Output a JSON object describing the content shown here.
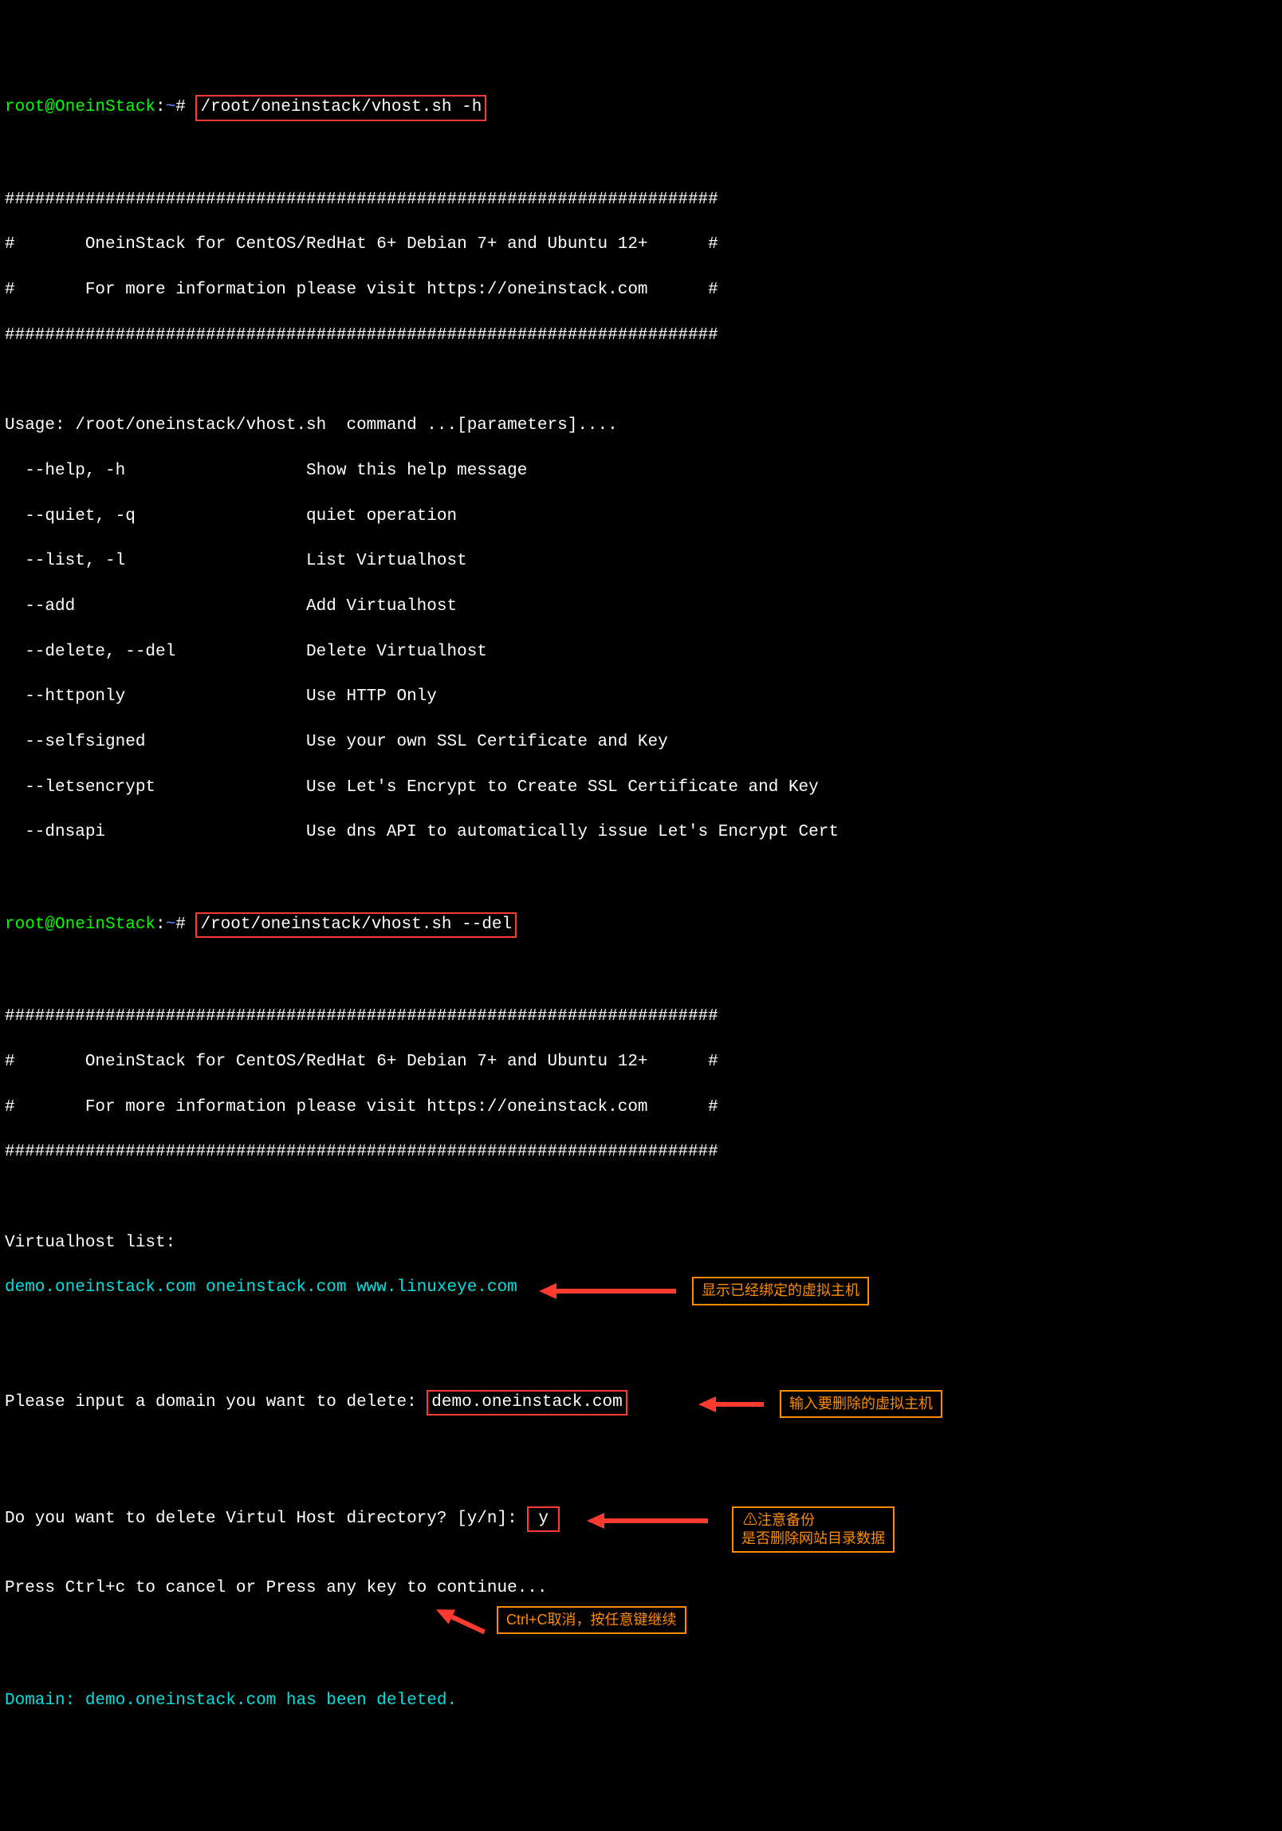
{
  "prompt1": {
    "user": "root@OneinStack",
    "sep": ":",
    "path": "~",
    "hash": "#",
    "command": "/root/oneinstack/vhost.sh -h"
  },
  "banner": {
    "hashline": "#######################################################################",
    "line1": "#       OneinStack for CentOS/RedHat 6+ Debian 7+ and Ubuntu 12+      #",
    "line2": "#       For more information please visit https://oneinstack.com      #"
  },
  "usage": {
    "header": "Usage: /root/oneinstack/vhost.sh  command ...[parameters]....",
    "rows": [
      "  --help, -h                  Show this help message",
      "  --quiet, -q                 quiet operation",
      "  --list, -l                  List Virtualhost",
      "  --add                       Add Virtualhost",
      "  --delete, --del             Delete Virtualhost",
      "  --httponly                  Use HTTP Only",
      "  --selfsigned                Use your own SSL Certificate and Key",
      "  --letsencrypt               Use Let's Encrypt to Create SSL Certificate and Key",
      "  --dnsapi                    Use dns API to automatically issue Let's Encrypt Cert"
    ]
  },
  "prompt2": {
    "user": "root@OneinStack",
    "sep": ":",
    "path": "~",
    "hash": "#",
    "command": "/root/oneinstack/vhost.sh --del"
  },
  "vhost": {
    "list_label": "Virtualhost list:",
    "hosts": "demo.oneinstack.com oneinstack.com www.linuxeye.com",
    "delete_prompt": "Please input a domain you want to delete: ",
    "delete_domain": "demo.oneinstack.com",
    "confirm_prompt": "Do you want to delete Virtul Host directory? [y/n]: ",
    "confirm_answer": "y",
    "cancel_hint": "Press Ctrl+c to cancel or Press any key to continue...",
    "result_prefix": "Domain: ",
    "result_domain": "demo.oneinstack.com",
    "result_suffix": " has been deleted."
  },
  "annotations": {
    "a1": "显示已经绑定的虚拟主机",
    "a2": "输入要删除的虚拟主机",
    "a3_line1": "⚠注意备份",
    "a3_line2": "是否删除网站目录数据",
    "a4": "Ctrl+C取消，按任意键继续"
  }
}
